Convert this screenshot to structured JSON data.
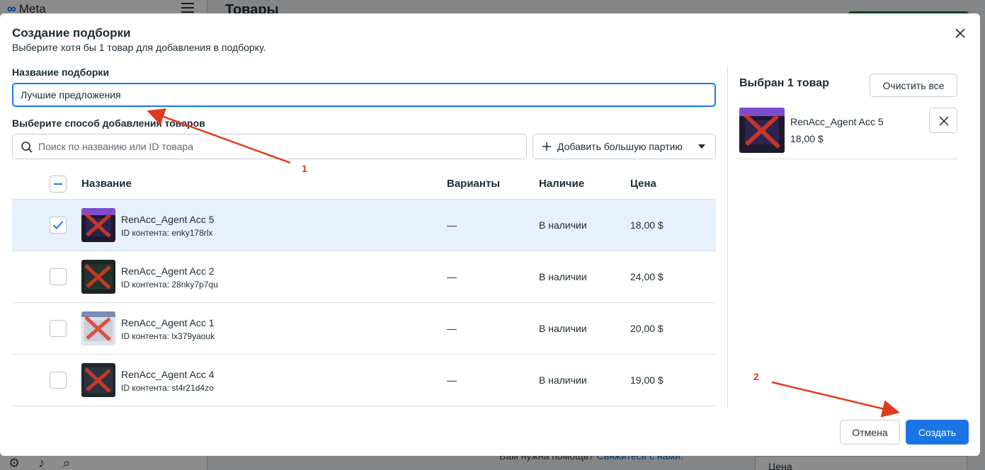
{
  "background": {
    "logo_text": "Meta",
    "page_title": "Товары",
    "help_text": "Вам нужна помощь?",
    "help_link": "Свяжитесь с нами.",
    "price_select": "Цена"
  },
  "modal": {
    "title": "Создание подборки",
    "subtitle": "Выберите хотя бы 1 товар для добавления в подборку.",
    "name_label": "Название подборки",
    "name_value": "Лучшие предложения",
    "method_label": "Выберите способ добавления товаров",
    "search_placeholder": "Поиск по названию или ID товара",
    "bulk_button": "Добавить большую партию",
    "table": {
      "headers": {
        "name": "Название",
        "variants": "Варианты",
        "availability": "Наличие",
        "price": "Цена"
      },
      "rows": [
        {
          "name": "RenAcc_Agent Acc 5",
          "id": "ID контента: enky178rlx",
          "variants": "—",
          "availability": "В наличии",
          "price": "18,00 $",
          "selected": true
        },
        {
          "name": "RenAcc_Agent Acc 2",
          "id": "ID контента: 28nky7p7qu",
          "variants": "—",
          "availability": "В наличии",
          "price": "24,00 $",
          "selected": false
        },
        {
          "name": "RenAcc_Agent Acc 1",
          "id": "ID контента: lx379yaouk",
          "variants": "—",
          "availability": "В наличии",
          "price": "20,00 $",
          "selected": false
        },
        {
          "name": "RenAcc_Agent Acc 4",
          "id": "ID контента: st4r21d4zo",
          "variants": "—",
          "availability": "В наличии",
          "price": "19,00 $",
          "selected": false
        }
      ]
    },
    "selected_panel": {
      "title": "Выбран 1 товар",
      "clear_button": "Очистить все",
      "items": [
        {
          "name": "RenAcc_Agent Acc 5",
          "price": "18,00 $"
        }
      ]
    },
    "cancel_button": "Отмена",
    "create_button": "Создать"
  },
  "annotations": {
    "label_1": "1",
    "label_2": "2"
  },
  "colors": {
    "accent": "#1b74e4",
    "selected_row": "#e7f0fd",
    "annotation": "#e23a1e"
  }
}
